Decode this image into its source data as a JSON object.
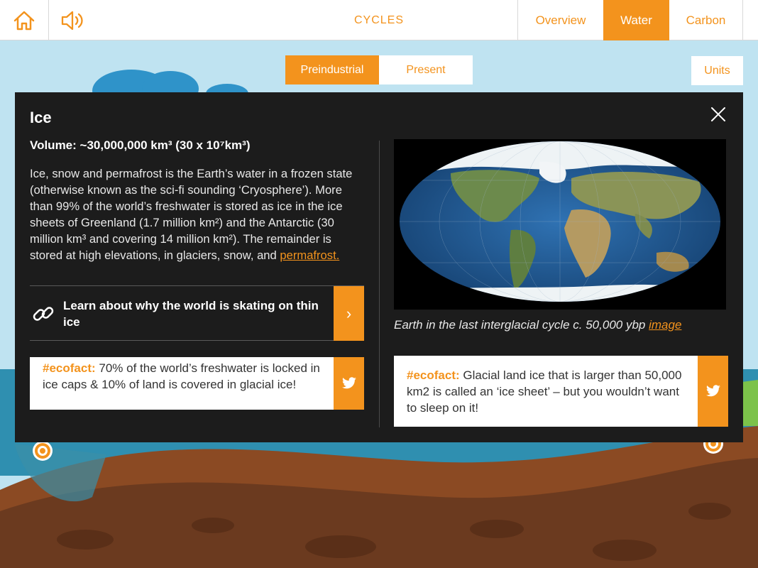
{
  "header": {
    "title": "CYCLES",
    "tabs": [
      {
        "label": "Overview",
        "active": false
      },
      {
        "label": "Water",
        "active": true
      },
      {
        "label": "Carbon",
        "active": false
      }
    ]
  },
  "period_toggle": {
    "options": [
      {
        "label": "Preindustrial",
        "active": true
      },
      {
        "label": "Present",
        "active": false
      }
    ]
  },
  "units_label": "Units",
  "modal": {
    "title": "Ice",
    "volume": "Volume: ~30,000,000 km³ (30 x 10⁷km³)",
    "description": "Ice, snow and permafrost is the Earth’s water in a frozen state (otherwise known as the sci-fi sounding ‘Cryosphere’). More than 99% of the world’s freshwater is stored as ice in the ice sheets of Greenland (1.7 million km²) and the Antarctic (30 million km³ and covering 14 million km²). The remainder is stored at high elevations, in glaciers, snow, and",
    "description_link": "permafrost.",
    "learn_link": "Learn about why the world is skating on thin ice",
    "ecofact_left": {
      "tag": "#ecofact:",
      "text": " 70% of the world’s freshwater is locked in ice caps & 10% of land is covered in glacial ice!"
    },
    "caption": "Earth in the last interglacial cycle c. 50,000 ybp",
    "caption_link": "image",
    "ecofact_right": {
      "tag": "#ecofact:",
      "text": " Glacial land ice that is larger than 50,000 km2 is called an ‘ice sheet’ – but you wouldn’t want to sleep on it!"
    }
  },
  "colors": {
    "accent": "#f3931d",
    "modal_bg": "#1c1c1c",
    "sky": "#bfe3f1",
    "ocean": "#2f8fb0",
    "soil": "#6b3a1f"
  },
  "icons": [
    "home-icon",
    "sound-icon",
    "close-icon",
    "link-icon",
    "chevron-right-icon",
    "twitter-icon",
    "marker-icon"
  ]
}
